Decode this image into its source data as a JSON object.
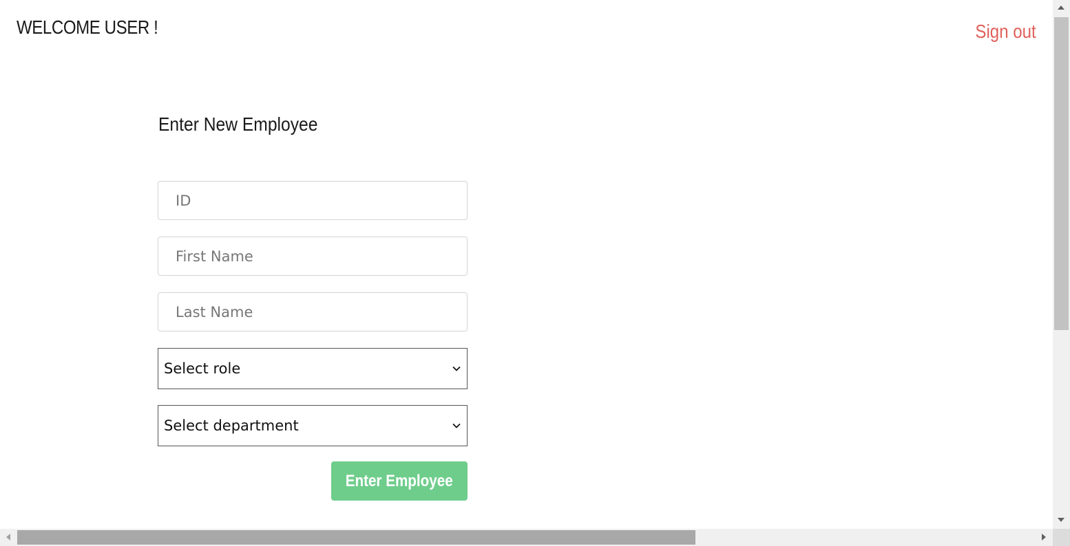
{
  "header": {
    "welcome_text": "WELCOME USER !",
    "signout_label": "Sign out"
  },
  "form": {
    "title": "Enter New Employee",
    "fields": {
      "id_placeholder": "ID",
      "first_name_placeholder": "First Name",
      "last_name_placeholder": "Last Name"
    },
    "role_select": {
      "selected": "Select role",
      "icon": "chevron-down-icon"
    },
    "department_select": {
      "selected": "Select department",
      "icon": "chevron-down-icon"
    },
    "submit_label": "Enter Employee"
  },
  "colors": {
    "accent_signout": "#e0605a",
    "submit_button": "#6fcd8c"
  }
}
